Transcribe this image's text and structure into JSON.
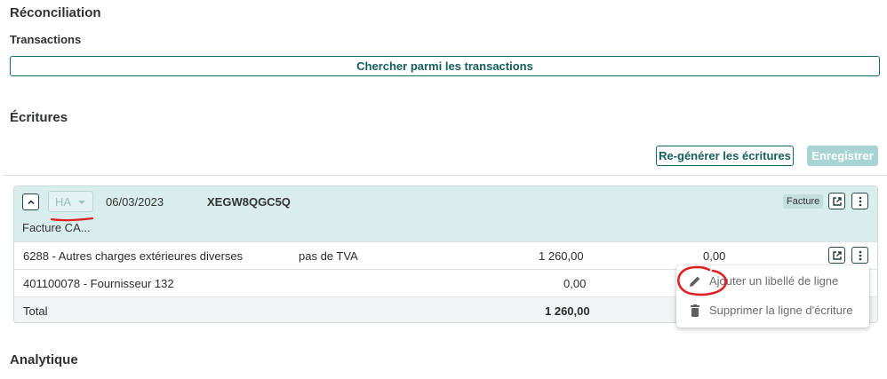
{
  "page": {
    "title": "Réconciliation",
    "transactions_label": "Transactions",
    "search_button": "Chercher parmi les transactions",
    "entries_title": "Écritures",
    "regenerate_button": "Re-générer les écritures",
    "save_button": "Enregistrer",
    "analytics_title": "Analytique"
  },
  "entry": {
    "journal": "HA",
    "date": "06/03/2023",
    "reference": "XEGW8QGC5Q",
    "label": "Facture CA...",
    "type_badge": "Facture",
    "lines": [
      {
        "account": "6288 - Autres charges extérieures diverses",
        "vat": "pas de TVA",
        "debit": "1 260,00",
        "credit": "0,00"
      },
      {
        "account": "401100078 - Fournisseur 132",
        "vat": "",
        "debit": "0,00",
        "credit": ""
      }
    ],
    "total_label": "Total",
    "total_debit": "1 260,00"
  },
  "context_menu": {
    "items": [
      {
        "label": "Ajouter un libellé de ligne",
        "icon": "pencil-icon"
      },
      {
        "label": "Supprimer la ligne d'écriture",
        "icon": "trash-icon"
      }
    ]
  },
  "colors": {
    "accent": "#1a6b6b",
    "header_bg": "#d9eeec",
    "save_disabled": "#a9d4d4",
    "annotation_red": "#e02020"
  }
}
